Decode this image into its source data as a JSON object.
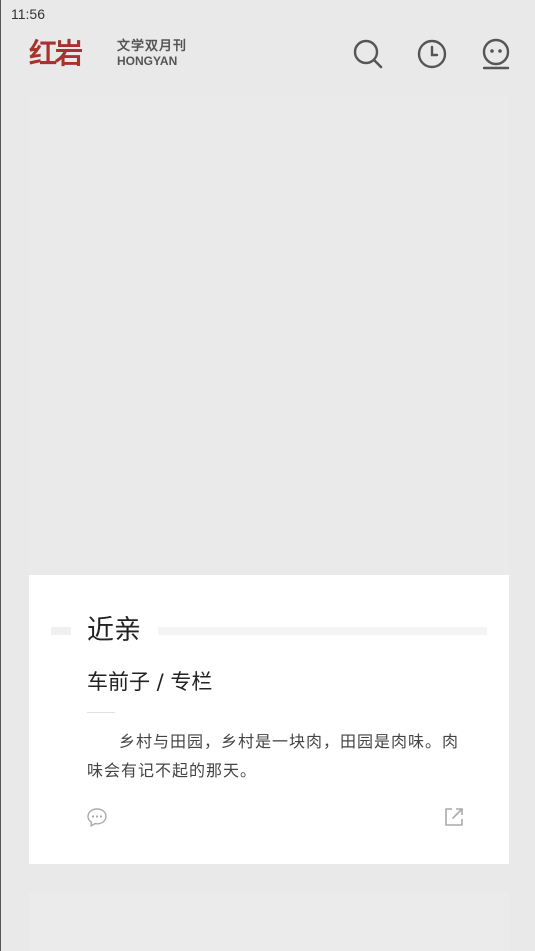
{
  "status_bar": {
    "time": "11:56"
  },
  "header": {
    "logo": {
      "mark": "红岩",
      "cn": "文学双月刊",
      "en": "HONGYAN"
    },
    "icons": [
      "search-icon",
      "history-clock-icon",
      "user-face-icon"
    ]
  },
  "colors": {
    "brand": "#a8322f",
    "icon": "#555555",
    "background": "#e8e9e8"
  },
  "card": {
    "title": "近亲",
    "byline": "车前子 / 专栏",
    "excerpt": "乡村与田园，乡村是一块肉，田园是肉味。肉味会有记不起的那天。"
  }
}
